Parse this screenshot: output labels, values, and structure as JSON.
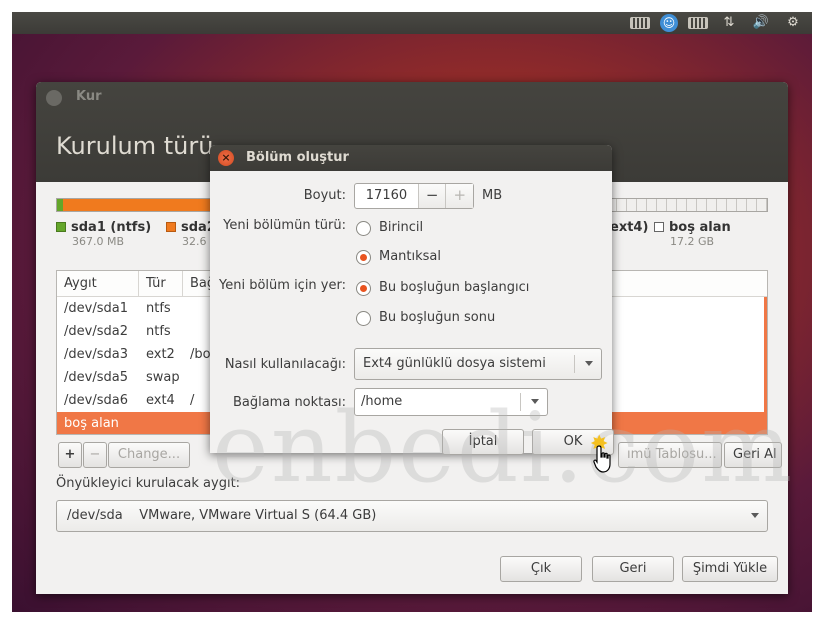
{
  "main_window": {
    "title": "Kur",
    "heading": "Kurulum türü",
    "legend": [
      {
        "name": "sda1 (ntfs)",
        "size": "367.0 MB",
        "color": "#64a62a"
      },
      {
        "name": "sda2",
        "size": "32.6",
        "color": "#f07a1e"
      },
      {
        "name": "ext4)",
        "size": "",
        "color": ""
      },
      {
        "name": "boş alan",
        "size": "17.2 GB",
        "color": "#ffffff"
      }
    ],
    "table": {
      "headers": [
        "Aygıt",
        "Tür",
        "Bağ"
      ],
      "rows": [
        [
          "/dev/sda1",
          "ntfs",
          ""
        ],
        [
          "/dev/sda2",
          "ntfs",
          ""
        ],
        [
          "/dev/sda3",
          "ext2",
          "/bo"
        ],
        [
          "/dev/sda5",
          "swap",
          ""
        ],
        [
          "/dev/sda6",
          "ext4",
          "/"
        ],
        [
          "boş alan",
          "",
          ""
        ]
      ]
    },
    "buttons": {
      "add": "+",
      "remove": "−",
      "change": "Change...",
      "new_table": "ımü Tablosu...",
      "revert": "Geri Al",
      "quit": "Çık",
      "back": "Geri",
      "install_now": "Şimdi Yükle"
    },
    "bootloader_label": "Önyükleyici kurulacak aygıt:",
    "bootloader_value": "/dev/sda    VMware, VMware Virtual S (64.4 GB)"
  },
  "dialog": {
    "title": "Bölüm oluştur",
    "size_label": "Boyut:",
    "size_value": "17160",
    "size_minus": "−",
    "size_plus": "+",
    "size_unit": "MB",
    "type_label": "Yeni bölümün türü:",
    "type_primary": "Birincil",
    "type_logical": "Mantıksal",
    "location_label": "Yeni bölüm için yer:",
    "location_start": "Bu boşluğun başlangıcı",
    "location_end": "Bu boşluğun sonu",
    "use_label": "Nasıl kullanılacağı:",
    "use_value": "Ext4 günlüklü dosya sistemi",
    "mount_label": "Bağlama noktası:",
    "mount_value": "/home",
    "cancel": "İptal",
    "ok": "OK"
  },
  "watermark": "enbedi.com",
  "colors": {
    "accent": "#e95420",
    "selection": "#f07746",
    "titlebar": "#3c3b37"
  }
}
